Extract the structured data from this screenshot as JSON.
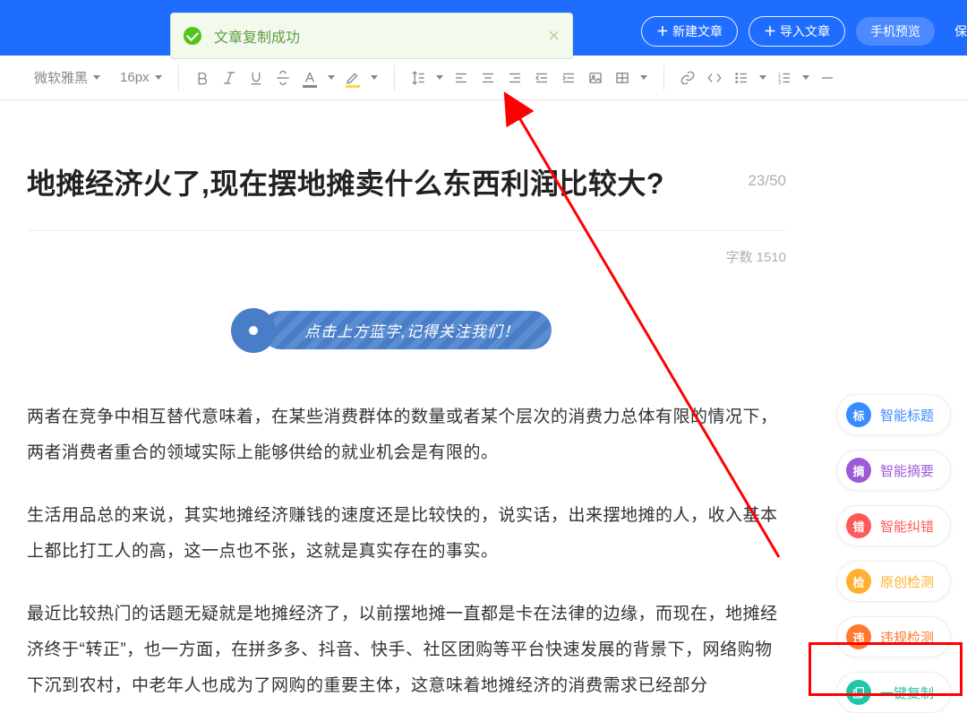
{
  "toast": {
    "message": "文章复制成功"
  },
  "topbar": {
    "new_article": "新建文章",
    "import_article": "导入文章",
    "mobile_preview": "手机预览",
    "save": "保"
  },
  "toolbar": {
    "font": "微软雅黑",
    "size": "16px"
  },
  "article": {
    "title": "地摊经济火了,现在摆地摊卖什么东西利润比较大?",
    "title_count": "23/50",
    "word_count_label": "字数 1510",
    "banner": "点击上方蓝字,记得关注我们！",
    "p1": "两者在竞争中相互替代意味着，在某些消费群体的数量或者某个层次的消费力总体有限的情况下，两者消费者重合的领域实际上能够供给的就业机会是有限的。",
    "p2": "生活用品总的来说，其实地摊经济赚钱的速度还是比较快的，说实话，出来摆地摊的人，收入基本上都比打工人的高，这一点也不张，这就是真实存在的事实。",
    "p3": "最近比较热门的话题无疑就是地摊经济了，以前摆地摊一直都是卡在法律的边缘，而现在，地摊经济终于“转正”，也一方面，在拼多多、抖音、快手、社区团购等平台快速发展的背景下，网络购物下沉到农村，中老年人也成为了网购的重要主体，这意味着地摊经济的消费需求已经部分"
  },
  "rail": {
    "items": [
      {
        "badge": "标",
        "label": "智能标题",
        "cls": "blue"
      },
      {
        "badge": "摘",
        "label": "智能摘要",
        "cls": "purple"
      },
      {
        "badge": "错",
        "label": "智能纠错",
        "cls": "red"
      },
      {
        "badge": "检",
        "label": "原创检测",
        "cls": "orange"
      },
      {
        "badge": "违",
        "label": "违规检测",
        "cls": "orange2"
      }
    ],
    "copy": {
      "label": "一键复制"
    }
  }
}
